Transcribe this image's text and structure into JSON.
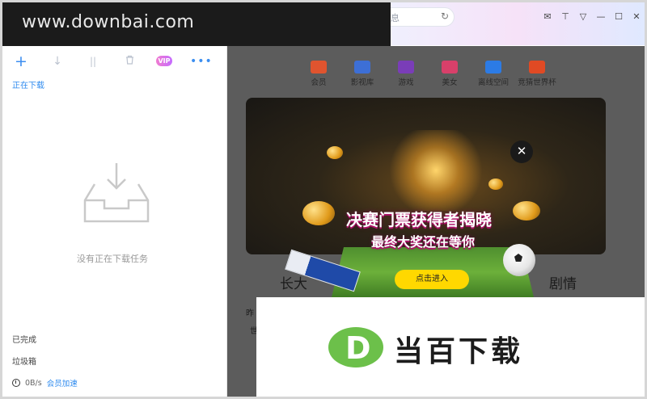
{
  "watermark": {
    "site": "www.downbai.com",
    "brand": "当百下载",
    "badge_letter": "D"
  },
  "titlebar": {
    "search_fragment": "息",
    "window_icons": [
      "mail-icon",
      "shirt-icon",
      "menu-icon",
      "minimize-icon",
      "maximize-icon",
      "close-icon"
    ]
  },
  "sidebar": {
    "toolbar": {
      "add": "+",
      "download": "↓",
      "pause": "||",
      "delete": "🗑",
      "vip": "VIP",
      "more": "•••"
    },
    "tab_downloading": "正在下载",
    "empty_message": "没有正在下载任务",
    "completed": "已完成",
    "trash": "垃圾箱",
    "speed": "0B/s",
    "speed_boost": "会员加速"
  },
  "main": {
    "categories": [
      {
        "label": "会员",
        "color": "#e0542f"
      },
      {
        "label": "影视库",
        "color": "#3d6fd6"
      },
      {
        "label": "游戏",
        "color": "#7a3db8"
      },
      {
        "label": "美女",
        "color": "#d8406a"
      },
      {
        "label": "离线空间",
        "color": "#2c7be5"
      },
      {
        "label": "竞猜世界杯",
        "color": "#e04a24"
      }
    ],
    "headline_left": "长大",
    "headline_right": "剧情",
    "small_line1": "昨",
    "small_line2": "世"
  },
  "popup": {
    "title_line1": "决赛门票获得者揭晓",
    "title_line2": "最终大奖还在等你",
    "enter_button": "点击进入",
    "close": "✕"
  }
}
